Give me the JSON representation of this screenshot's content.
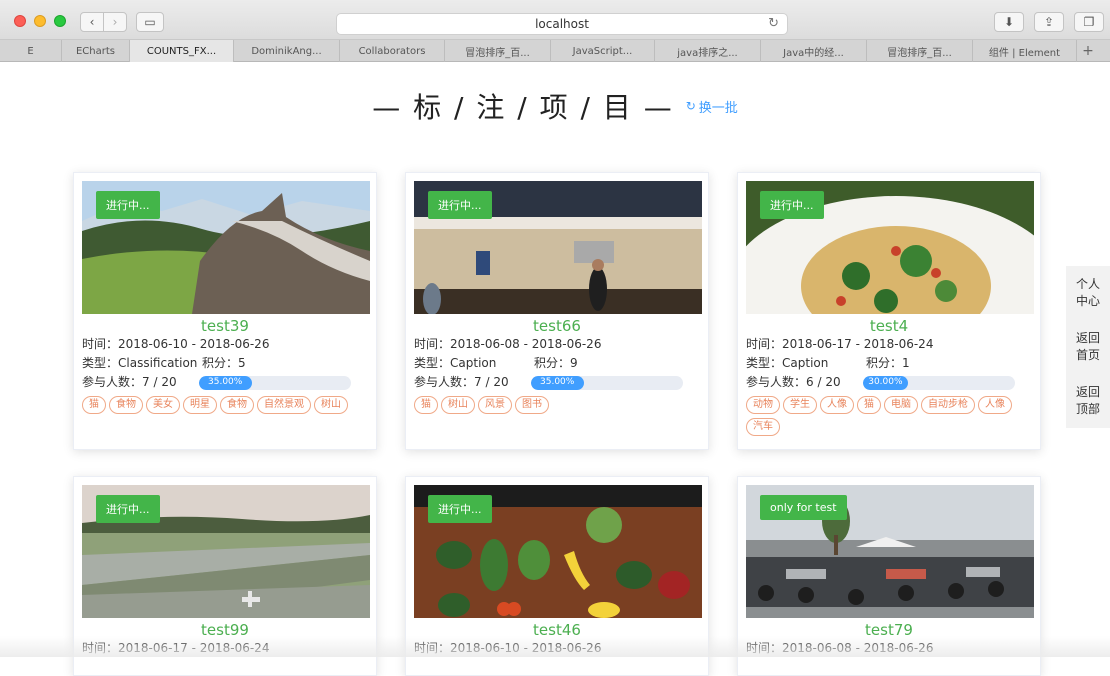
{
  "browser": {
    "address": "localhost",
    "tabs": [
      {
        "label": "E",
        "width": 0
      },
      {
        "label": "ECharts"
      },
      {
        "label": "COUNTS_FX..."
      },
      {
        "label": "DominikAng..."
      },
      {
        "label": "Collaborators"
      },
      {
        "label": "冒泡排序_百..."
      },
      {
        "label": "JavaScript..."
      },
      {
        "label": "java排序之..."
      },
      {
        "label": "Java中的经..."
      },
      {
        "label": "冒泡排序_百..."
      },
      {
        "label": "组件 | Element"
      }
    ],
    "new_tab": "+",
    "icons": {
      "back": "chevron-left-icon",
      "forward": "chevron-right-icon",
      "sidebar": "sidebar-icon",
      "reload": "reload-icon",
      "download": "download-icon",
      "share": "share-icon",
      "tabs": "tabs-overview-icon"
    }
  },
  "page": {
    "title": "— 标 / 注 / 项 / 目 —",
    "refresh_label": "换一批",
    "refresh_icon": "refresh-icon"
  },
  "labels": {
    "time_prefix": "时间：",
    "type_prefix": "类型：",
    "score_prefix": "积分：",
    "participants_prefix": "参与人数："
  },
  "projects": [
    {
      "status": "进行中...",
      "name": "test39",
      "time": "2018-06-10 - 2018-06-26",
      "type": "Classification",
      "score": "5",
      "participants": "7 / 20",
      "progress": 35,
      "progress_text": "35.00%",
      "tags": [
        "猫",
        "食物",
        "美女",
        "明星",
        "食物",
        "自然景观",
        "树山"
      ],
      "image": "horse-on-hill"
    },
    {
      "status": "进行中...",
      "name": "test66",
      "time": "2018-06-08 - 2018-06-26",
      "type": "Caption",
      "score": "9",
      "participants": "7 / 20",
      "progress": 35,
      "progress_text": "35.00%",
      "tags": [
        "猫",
        "树山",
        "风景",
        "图书"
      ],
      "image": "kitchen"
    },
    {
      "status": "进行中...",
      "name": "test4",
      "time": "2018-06-17 - 2018-06-24",
      "type": "Caption",
      "score": "1",
      "participants": "6 / 20",
      "progress": 30,
      "progress_text": "30.00%",
      "tags": [
        "动物",
        "学生",
        "人像",
        "猫",
        "电脑",
        "自动步枪",
        "人像",
        "汽车"
      ],
      "image": "pasta-broccoli"
    },
    {
      "status": "进行中...",
      "name": "test99",
      "time": "2018-06-17 - 2018-06-24",
      "image": "airplane-runway"
    },
    {
      "status": "进行中...",
      "name": "test46",
      "time": "2018-06-10 - 2018-06-26",
      "image": "vegetables-table"
    },
    {
      "status": "only for test",
      "name": "test79",
      "time": "2018-06-08 - 2018-06-26",
      "image": "motorcycles-parking"
    }
  ],
  "side_nav": {
    "personal": "个人中心",
    "home": "返回首页",
    "top": "返回顶部"
  },
  "colors": {
    "badge": "#43b549",
    "name": "#4caf50",
    "progress": "#409eff",
    "tag": "#e8845c",
    "refresh": "#409eff"
  }
}
